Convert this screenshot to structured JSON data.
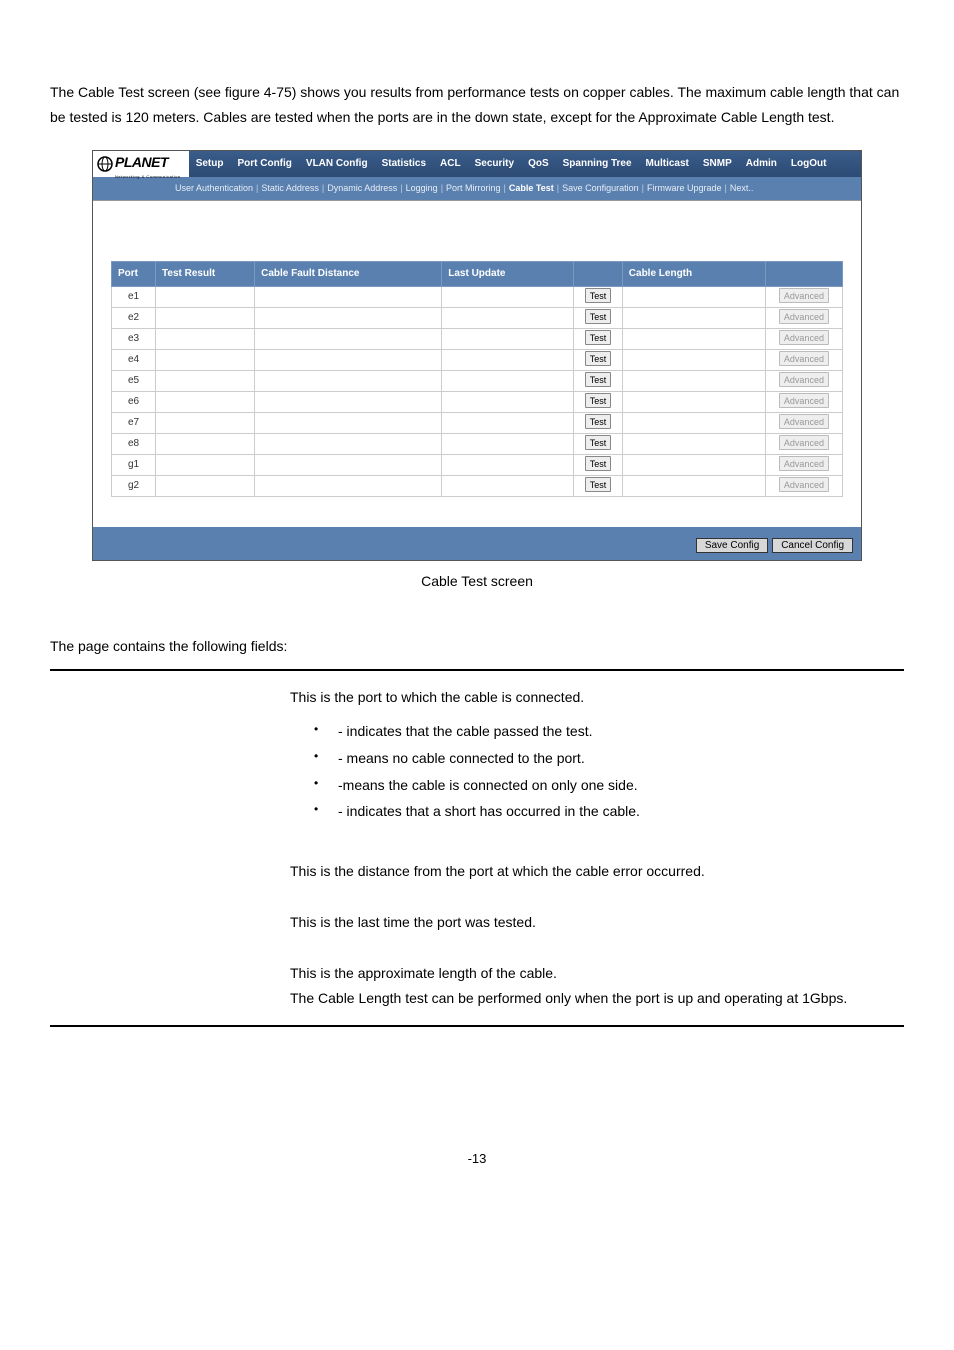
{
  "intro": "The Cable Test screen (see figure 4-75) shows you results from performance tests on copper cables. The maximum cable length that can be tested is 120 meters. Cables are tested when the ports are in the down state, except for the Approximate Cable Length test.",
  "logo": {
    "text": "PLANET",
    "sub": "Networking & Communication"
  },
  "menu": [
    "Setup",
    "Port Config",
    "VLAN Config",
    "Statistics",
    "ACL",
    "Security",
    "QoS",
    "Spanning Tree",
    "Multicast",
    "SNMP",
    "Admin",
    "LogOut"
  ],
  "submenu": [
    "User Authentication",
    "Static Address",
    "Dynamic Address",
    "Logging",
    "Port Mirroring",
    "Cable Test",
    "Save Configuration",
    "Firmware Upgrade",
    "Next.."
  ],
  "submenu_active": "Cable Test",
  "headers": {
    "port": "Port",
    "result": "Test Result",
    "dist": "Cable Fault Distance",
    "update": "Last Update",
    "action": "",
    "len": "Cable Length",
    "adv": ""
  },
  "rows": [
    {
      "port": "e1"
    },
    {
      "port": "e2"
    },
    {
      "port": "e3"
    },
    {
      "port": "e4"
    },
    {
      "port": "e5"
    },
    {
      "port": "e6"
    },
    {
      "port": "e7"
    },
    {
      "port": "e8"
    },
    {
      "port": "g1"
    },
    {
      "port": "g2"
    }
  ],
  "btn_test": "Test",
  "btn_adv": "Advanced",
  "save": "Save Config",
  "cancel": "Cancel Config",
  "chart_data": {
    "type": "table",
    "columns": [
      "Port",
      "Test Result",
      "Cable Fault Distance",
      "Last Update",
      "",
      "Cable Length",
      ""
    ],
    "rows": [
      [
        "e1",
        "",
        "",
        "",
        "Test",
        "",
        "Advanced"
      ],
      [
        "e2",
        "",
        "",
        "",
        "Test",
        "",
        "Advanced"
      ],
      [
        "e3",
        "",
        "",
        "",
        "Test",
        "",
        "Advanced"
      ],
      [
        "e4",
        "",
        "",
        "",
        "Test",
        "",
        "Advanced"
      ],
      [
        "e5",
        "",
        "",
        "",
        "Test",
        "",
        "Advanced"
      ],
      [
        "e6",
        "",
        "",
        "",
        "Test",
        "",
        "Advanced"
      ],
      [
        "e7",
        "",
        "",
        "",
        "Test",
        "",
        "Advanced"
      ],
      [
        "e8",
        "",
        "",
        "",
        "Test",
        "",
        "Advanced"
      ],
      [
        "g1",
        "",
        "",
        "",
        "Test",
        "",
        "Advanced"
      ],
      [
        "g2",
        "",
        "",
        "",
        "Test",
        "",
        "Advanced"
      ]
    ]
  },
  "caption": "Cable Test screen",
  "fields_intro": "The page contains the following fields:",
  "fields": {
    "port": "This is the port to which the cable is connected.",
    "bullets": [
      "- indicates that the cable passed the test.",
      "- means no cable connected to the port.",
      "-means the cable is connected on only one side.",
      "- indicates that a short has occurred in the cable."
    ],
    "dist": "This is the distance from the port at which the cable error occurred.",
    "upd": "This is the last time the port was tested.",
    "len1": "This is the approximate length of the cable.",
    "len2": "The Cable Length test can be performed only when the port is up and operating at 1Gbps."
  },
  "pagenum": "-13"
}
